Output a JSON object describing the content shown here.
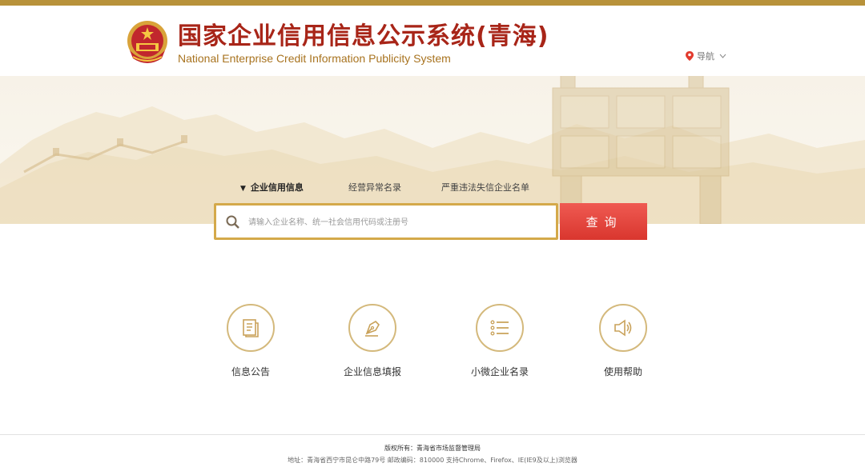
{
  "header": {
    "title_cn": "国家企业信用信息公示系统(青海)",
    "title_en": "National Enterprise Credit Information Publicity System",
    "nav_label": "导航"
  },
  "search": {
    "tabs": [
      {
        "label": "企业信用信息",
        "active": true
      },
      {
        "label": "经营异常名录",
        "active": false
      },
      {
        "label": "严重违法失信企业名单",
        "active": false
      }
    ],
    "placeholder": "请输入企业名称、统一社会信用代码或注册号",
    "button_label": "查询"
  },
  "features": [
    {
      "label": "信息公告",
      "icon": "document-icon"
    },
    {
      "label": "企业信息填报",
      "icon": "pen-nib-icon"
    },
    {
      "label": "小微企业名录",
      "icon": "list-icon"
    },
    {
      "label": "使用帮助",
      "icon": "speaker-icon"
    }
  ],
  "footer": {
    "copyright": "版权所有：青海省市场监督管理局",
    "address": "地址：青海省西宁市昆仑中路79号 邮政编码：810000 支持Chrome、Firefox、IE(IE9及以上)浏览器"
  },
  "colors": {
    "brand_red": "#a82518",
    "gold": "#b8923a",
    "button_red": "#e2463f"
  }
}
